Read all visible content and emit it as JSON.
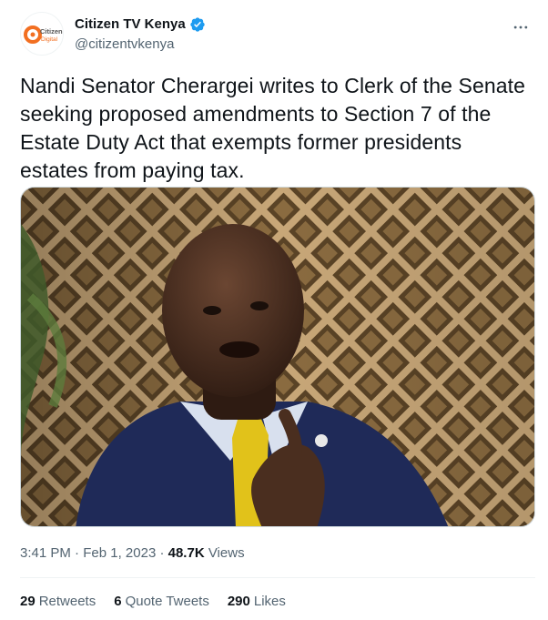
{
  "author": {
    "display_name": "Citizen TV Kenya",
    "handle": "@citizentvkenya",
    "verified": true,
    "avatar_text_top": "Citizen",
    "avatar_text_bottom": "Digital",
    "brand_color": "#f26f21",
    "verified_color": "#1d9bf0"
  },
  "more_icon": "more-horizontal-icon",
  "tweet": {
    "text": "Nandi Senator Cherargei writes to Clerk of the Senate\nseeking proposed amendments to Section 7 of the\nEstate Duty Act that exempts former presidents\nestates from paying tax.",
    "media_description": "photo-of-senator"
  },
  "meta": {
    "time": "3:41 PM",
    "separator": "·",
    "date": "Feb 1, 2023",
    "views_count": "48.7K",
    "views_label": "Views"
  },
  "stats": {
    "retweets_count": "29",
    "retweets_label": "Retweets",
    "quotes_count": "6",
    "quotes_label": "Quote Tweets",
    "likes_count": "290",
    "likes_label": "Likes"
  }
}
